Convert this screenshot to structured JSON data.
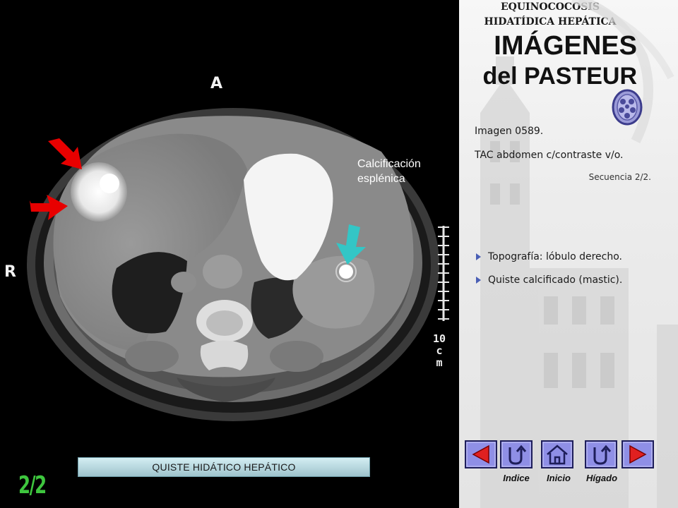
{
  "scan": {
    "orientation_top": "A",
    "orientation_side": "R",
    "scale_label": [
      "10",
      "c",
      "m"
    ],
    "annotation": [
      "Calcificación",
      "esplénica"
    ],
    "caption": "QUISTE HIDÁTICO HEPÁTICO",
    "arrows": [
      {
        "icon": "red-arrow-icon",
        "color": "#e80000"
      },
      {
        "icon": "red-arrow-icon",
        "color": "#e80000"
      },
      {
        "icon": "cyan-arrow-icon",
        "color": "#33c6c6"
      }
    ]
  },
  "page_indicator": "2/2",
  "title": {
    "line1": "IMÁGENES",
    "line2": "del PASTEUR"
  },
  "info": {
    "image_number": "Imagen 0589.",
    "study_type": "TAC abdomen c/contraste v/o.",
    "sequence": "Secuencia  2/2.",
    "diagnosis": [
      "EQUINOCOCOSIS",
      "HIDATÍDICA HEPÁTICA"
    ],
    "bullets": [
      "Topografía: lóbulo derecho.",
      "Quiste calcificado (mastic)."
    ]
  },
  "navigation": {
    "prev": {
      "icon": "triangle-left-icon"
    },
    "index": {
      "icon": "return-arrow-icon",
      "label": "Indice"
    },
    "home": {
      "icon": "house-icon",
      "label": "Inicio"
    },
    "liver": {
      "icon": "return-arrow-icon",
      "label": "Hígado"
    },
    "next": {
      "icon": "triangle-right-icon"
    }
  },
  "colors": {
    "button_fill": "#8f8fe6",
    "arrow_red": "#e80000",
    "arrow_cyan": "#33c6c6",
    "page_indicator": "#3ec63e",
    "caption_bar": "#b7dde5"
  }
}
